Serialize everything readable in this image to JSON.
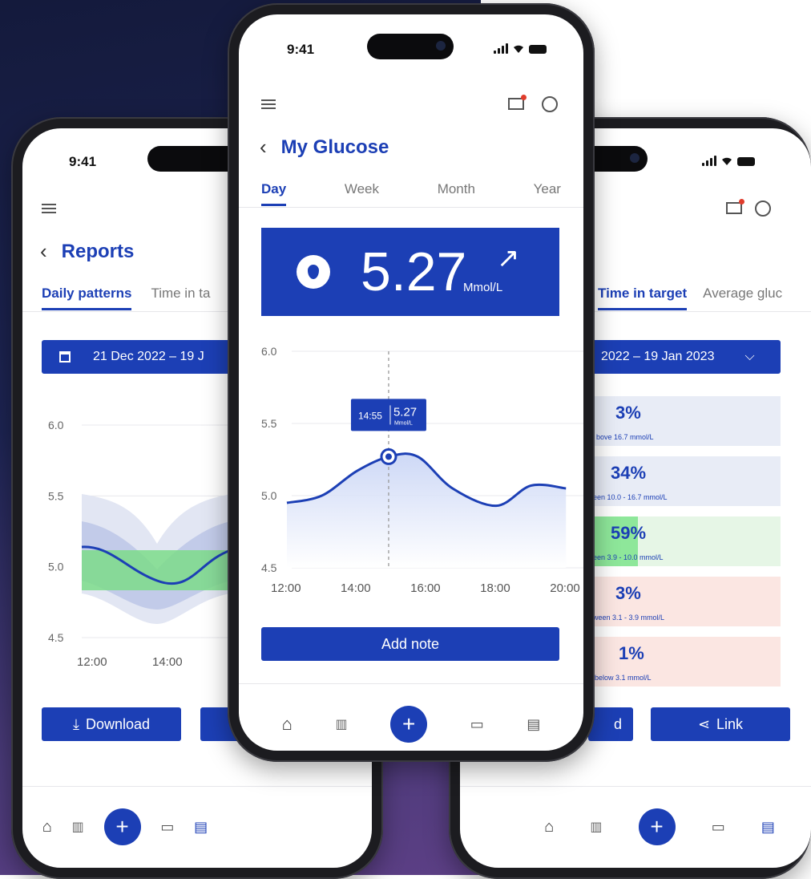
{
  "status": {
    "time": "9:41"
  },
  "center": {
    "title": "My Glucose",
    "tabs": [
      "Day",
      "Week",
      "Month",
      "Year"
    ],
    "reading": {
      "value": "5.27",
      "unit": "Mmol/L",
      "trend_icon": "arrow-up-right-icon"
    },
    "tooltip": {
      "time": "14:55",
      "value": "5.27",
      "unit": "Mmol/L"
    },
    "add_note": "Add note"
  },
  "left": {
    "title": "Reports",
    "tabs": [
      "Daily patterns",
      "Time in ta"
    ],
    "date_range": "21 Dec 2022 – 19 J",
    "download": "Download"
  },
  "right": {
    "tabs": [
      "Time in target",
      "Average gluc"
    ],
    "date_range": "2022 – 19 Jan 2023",
    "link": "Link",
    "download_partial": "d",
    "tiles": [
      {
        "pct": "3%",
        "label": "bove 16.7 mmol/L",
        "color": "#e8ecf6"
      },
      {
        "pct": "34%",
        "label": "een 10.0 - 16.7 mmol/L",
        "color": "#e8ecf6"
      },
      {
        "pct": "59%",
        "label": "een 3.9 - 10.0 mmol/L",
        "color": "#e6f6e6"
      },
      {
        "pct": "3%",
        "label": "ween 3.1 - 3.9 mmol/L",
        "color": "#fbe6e2"
      },
      {
        "pct": "1%",
        "label": "below 3.1 mmol/L",
        "color": "#fbe6e2"
      }
    ]
  },
  "chart_data": [
    {
      "type": "line",
      "x": [
        "12:00",
        "13:00",
        "14:00",
        "14:55",
        "15:45",
        "16:45",
        "18:00",
        "19:00",
        "20:00"
      ],
      "values": [
        4.95,
        5.0,
        5.17,
        5.27,
        5.27,
        5.05,
        4.93,
        5.07,
        5.05
      ],
      "xticks": [
        "12:00",
        "14:00",
        "16:00",
        "18:00",
        "20:00"
      ],
      "yticks": [
        "6.0",
        "5.5",
        "5.0",
        "4.5"
      ],
      "ylim": [
        4.5,
        6.0
      ]
    },
    {
      "type": "area",
      "x": [
        "12:00",
        "14:00",
        "16:00"
      ],
      "yticks": [
        "6.0",
        "5.5",
        "5.0",
        "4.5"
      ],
      "xticks": [
        "12:00",
        "14:00",
        "16:"
      ],
      "ylim": [
        4.5,
        6.0
      ],
      "target_band": [
        4.8,
        5.0
      ],
      "median": [
        5.05,
        4.76,
        5.0
      ]
    }
  ]
}
